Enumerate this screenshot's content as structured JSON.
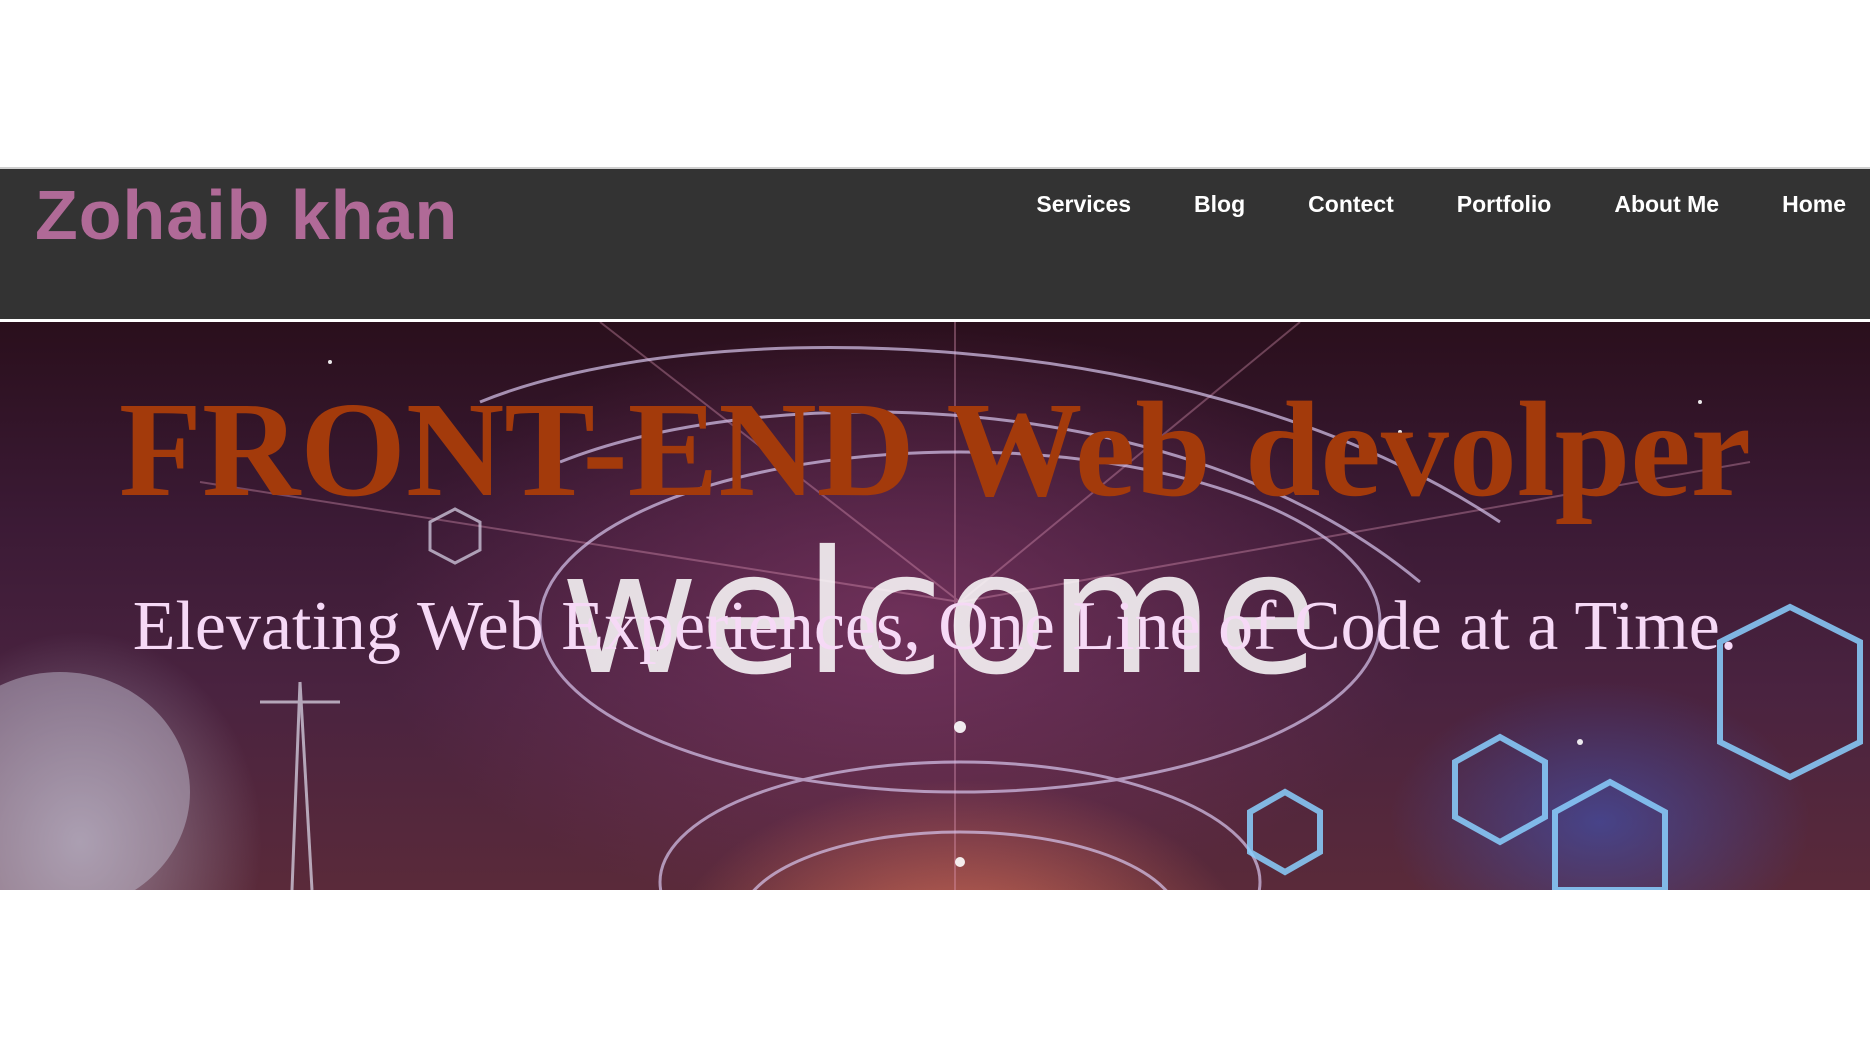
{
  "header": {
    "brand": "Zohaib khan",
    "nav": [
      {
        "label": "Services"
      },
      {
        "label": "Blog"
      },
      {
        "label": "Contect"
      },
      {
        "label": "Portfolio"
      },
      {
        "label": "About Me"
      },
      {
        "label": "Home"
      }
    ]
  },
  "hero": {
    "title": "FRONT-END Web devolper",
    "subtitle": "Elevating Web Experiences, One Line of Code at a Time.",
    "background_word": "welcome"
  },
  "colors": {
    "navbar_bg": "#333333",
    "brand": "#b06a97",
    "nav_text": "#ffffff",
    "hero_title": "#a33a0b",
    "hero_subtitle": "#f6d9f6"
  }
}
